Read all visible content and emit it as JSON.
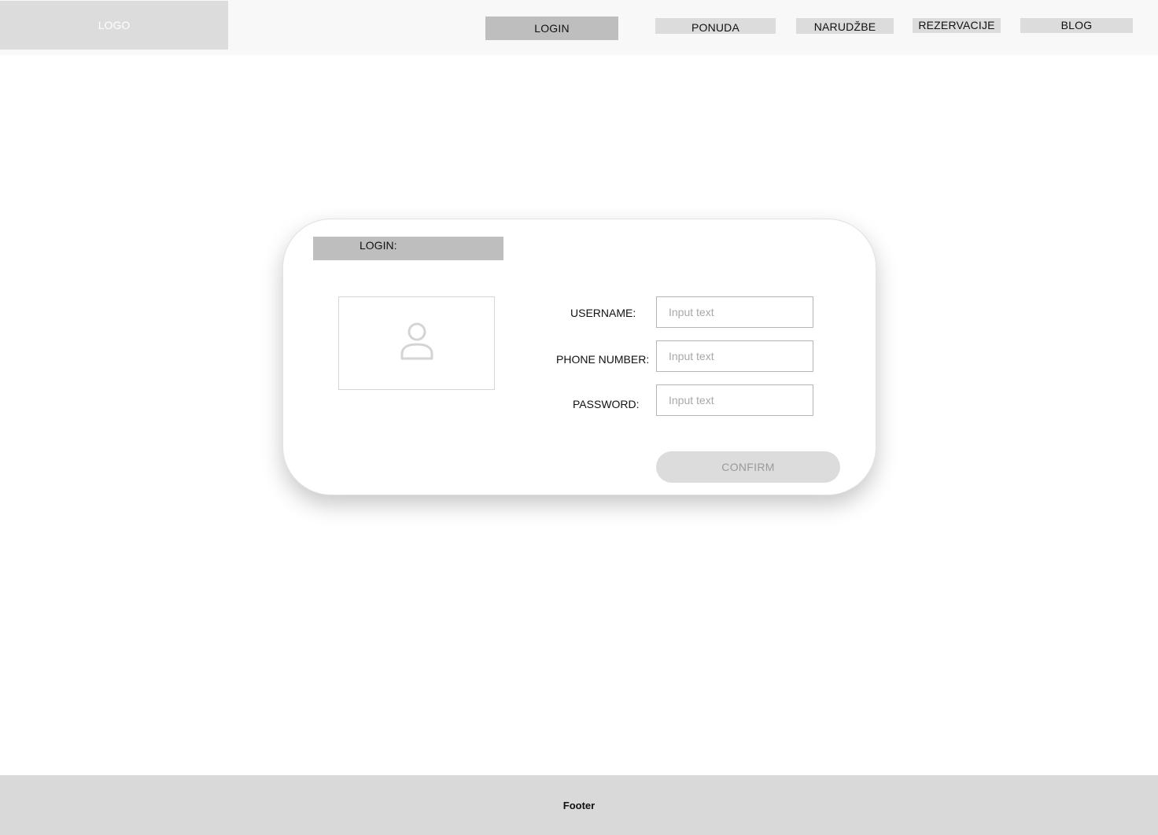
{
  "header": {
    "logo_text": "LOGO",
    "nav": {
      "login": "LOGIN",
      "ponuda": "PONUDA",
      "narudzbe": "NARUDŽBE",
      "rezervacije": "REZERVACIJE",
      "blog": "BLOG"
    }
  },
  "login_card": {
    "title": "LOGIN:",
    "avatar_icon": "user-icon",
    "fields": {
      "username": {
        "label": "USERNAME:",
        "placeholder": "Input text",
        "value": ""
      },
      "phone": {
        "label": "PHONE NUMBER:",
        "placeholder": "Input text",
        "value": ""
      },
      "password": {
        "label": "PASSWORD:",
        "placeholder": "Input text",
        "value": ""
      }
    },
    "confirm_label": "CONFIRM"
  },
  "footer": {
    "text": "Footer"
  },
  "colors": {
    "header_bg": "#f8f8f8",
    "logo_bg": "#dcdcdc",
    "active_nav_bg": "#bebebe",
    "nav_bg": "#dcdcdc",
    "footer_bg": "#d9d9d9",
    "confirm_bg": "#dcdcdc"
  }
}
